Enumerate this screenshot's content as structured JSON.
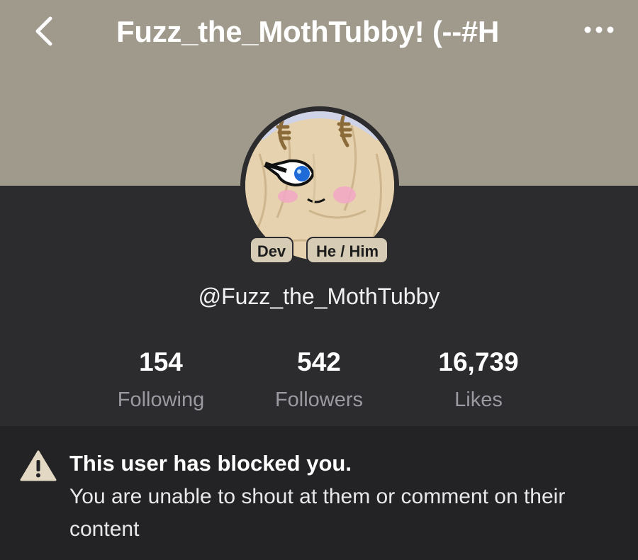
{
  "header": {
    "title": "Fuzz_the_MothTubby! (--#H",
    "back_icon": "chevron-left-icon",
    "more_icon": "more-dots-icon"
  },
  "profile": {
    "tags": [
      "Dev",
      "He / Him"
    ],
    "handle": "@Fuzz_the_MothTubby"
  },
  "stats": [
    {
      "value": "154",
      "label": "Following"
    },
    {
      "value": "542",
      "label": "Followers"
    },
    {
      "value": "16,739",
      "label": "Likes"
    }
  ],
  "notice": {
    "icon": "warning-icon",
    "title": "This user has blocked you.",
    "body": "You are unable to shout at them or comment on their content"
  },
  "colors": {
    "banner": "#a09a8c",
    "background": "#2c2c2f",
    "notice_background": "#232325",
    "tag_background": "#d6cbb5"
  }
}
